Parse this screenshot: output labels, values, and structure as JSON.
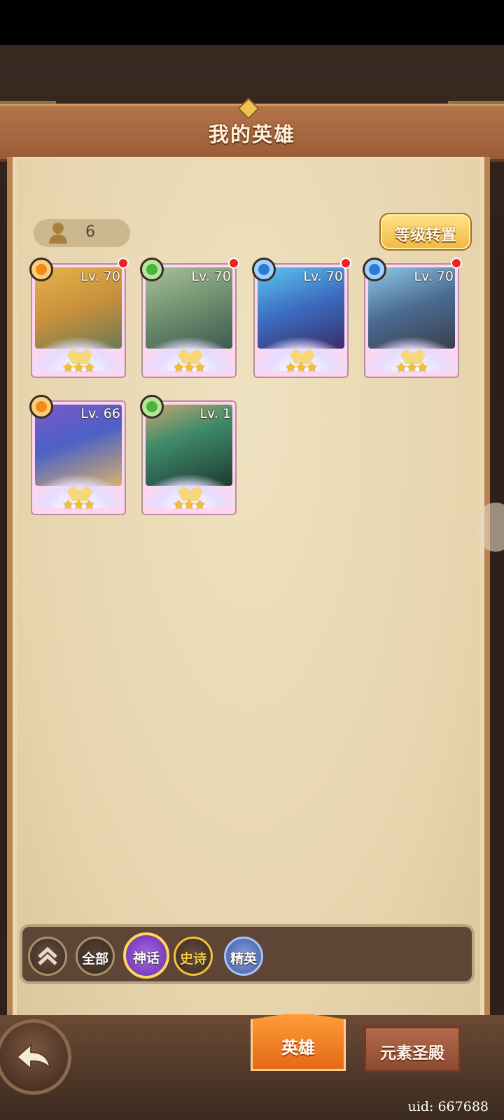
{
  "header": {
    "title": "我的英雄"
  },
  "hero_count": {
    "value": "6"
  },
  "level_transfer_button": {
    "label": "等级转置"
  },
  "heroes": [
    {
      "level": "Lv. 70",
      "element": "fire",
      "stars": "★★★",
      "has_alert": true
    },
    {
      "level": "Lv. 70",
      "element": "wind",
      "stars": "★★★",
      "has_alert": true
    },
    {
      "level": "Lv. 70",
      "element": "water",
      "stars": "★★★",
      "has_alert": true
    },
    {
      "level": "Lv. 70",
      "element": "water",
      "stars": "★★★",
      "has_alert": true
    },
    {
      "level": "Lv. 66",
      "element": "fire",
      "stars": "★★★",
      "has_alert": false
    },
    {
      "level": "Lv. 1",
      "element": "wind",
      "stars": "★★★",
      "has_alert": false
    }
  ],
  "filters": {
    "all": "全部",
    "mythic": "神话",
    "epic": "史诗",
    "elite": "精英"
  },
  "bottom_tabs": {
    "heroes": "英雄",
    "temple": "元素圣殿"
  },
  "uid": "uid: 667688",
  "colors": {
    "fire": "#f08a1c",
    "wind": "#49b33a",
    "water": "#2b7bd6"
  }
}
